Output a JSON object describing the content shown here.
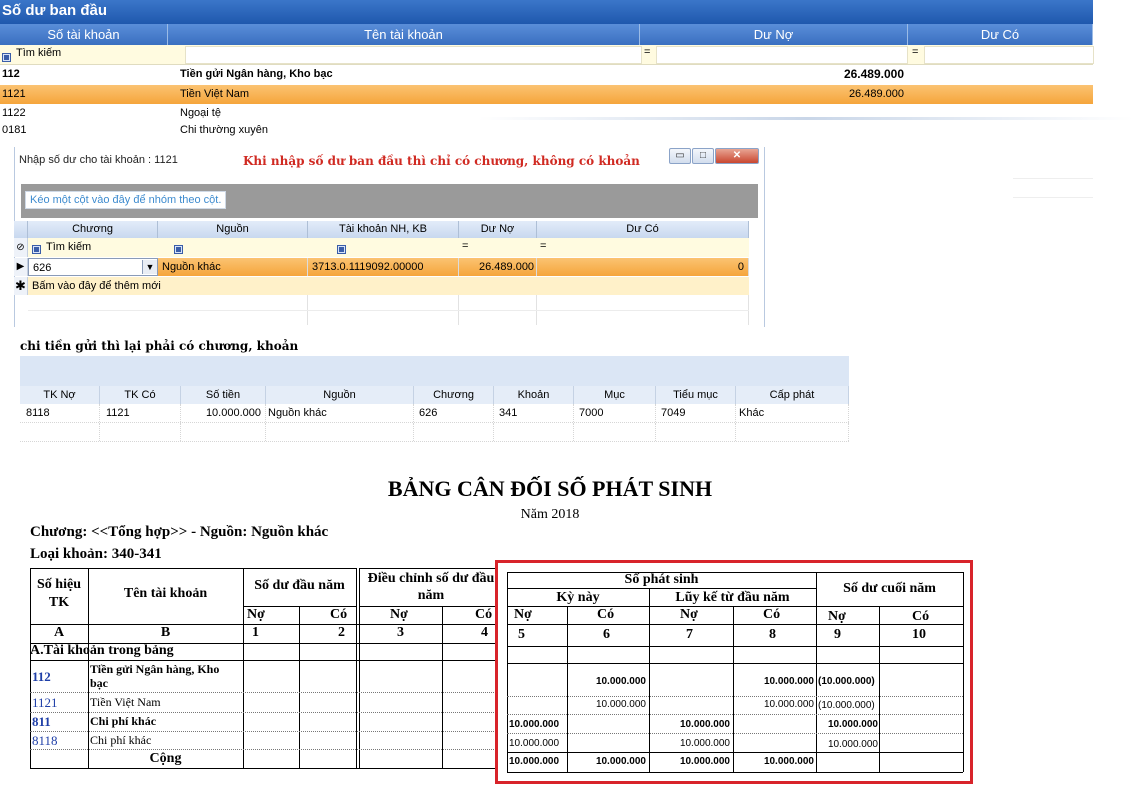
{
  "top_grid": {
    "title": "Số dư ban đầu",
    "columns": [
      "Số tài khoản",
      "Tên tài khoản",
      "Dư Nợ",
      "Dư Có"
    ],
    "filter_label": "Tìm kiếm",
    "filter_eq": "=",
    "rows": [
      {
        "code": "112",
        "name": "Tiền gửi Ngân hàng, Kho bạc",
        "debit": "26.489.000",
        "credit": "",
        "bold": true
      },
      {
        "code": "1121",
        "name": "Tiền Việt Nam",
        "debit": "26.489.000",
        "credit": "",
        "selected": true
      },
      {
        "code": "1122",
        "name": "Ngoại tệ",
        "debit": "",
        "credit": ""
      },
      {
        "code": "0181",
        "name": "Chi thường xuyên",
        "debit": "",
        "credit": ""
      }
    ]
  },
  "dialog": {
    "title": "Nhập số dư cho tài khoản : 1121",
    "note": "Khi nhập số dư ban đầu thì chỉ có chương, không có khoản",
    "group_hint": "Kéo một cột vào đây để nhóm theo cột.",
    "window_buttons": {
      "minimize": "▭",
      "maximize": "□",
      "close": "✕"
    },
    "columns": [
      "Chương",
      "Nguồn",
      "Tài khoản NH, KB",
      "Dư Nợ",
      "Dư Có"
    ],
    "filter_label": "Tìm kiếm",
    "filter_eq": "=",
    "row": {
      "chuong": "626",
      "nguon": "Nguồn khác",
      "tk_nh": "3713.0.1119092.00000",
      "du_no": "26.489.000",
      "du_co": "0"
    },
    "add_new": "Bấm vào đây để thêm mới"
  },
  "middle": {
    "caption": "chi tiền gửi thì lại phải có chương, khoản",
    "columns": [
      "TK Nợ",
      "TK Có",
      "Số tiền",
      "Nguồn",
      "Chương",
      "Khoản",
      "Mục",
      "Tiểu mục",
      "Cấp phát"
    ],
    "row": {
      "tk_no": "8118",
      "tk_co": "1121",
      "so_tien": "10.000.000",
      "nguon": "Nguồn khác",
      "chuong": "626",
      "khoan": "341",
      "muc": "7000",
      "tieu_muc": "7049",
      "cap_phat": "Khác"
    }
  },
  "report": {
    "title": "BẢNG CÂN ĐỐI SỐ PHÁT SINH",
    "year": "Năm 2018",
    "chuong_line": "Chương: <<Tổng hợp>> - Nguồn: Nguồn khác",
    "loai_line": "Loại khoản: 340-341",
    "h_so_hieu": "Số hiệu TK",
    "h_ten": "Tên tài khoản",
    "h_sddn": "Số dư đầu năm",
    "h_dieu_chinh": "Điều chỉnh số dư đầu năm",
    "h_spsinh": "Số phát sinh",
    "h_ky_nay": "Kỳ này",
    "h_luy_ke": "Lũy kế từ đầu năm",
    "h_sdcn": "Số dư cuối năm",
    "no": "Nợ",
    "co": "Có",
    "col_letters": [
      "A",
      "B"
    ],
    "col_numbers": [
      "1",
      "2",
      "3",
      "4",
      "5",
      "6",
      "7",
      "8",
      "9",
      "10"
    ],
    "section_a": "A.Tài khoản trong bảng",
    "rows": [
      {
        "code": "112",
        "name": "Tiền gửi Ngân hàng, Kho bạc",
        "c6": "10.000.000",
        "c8": "10.000.000",
        "c9": "(10.000.000)"
      },
      {
        "code": "1121",
        "name": "Tiền Việt Nam",
        "c6": "10.000.000",
        "c8": "10.000.000",
        "c9": "(10.000.000)"
      },
      {
        "code": "811",
        "name": "Chi phí khác",
        "c5": "10.000.000",
        "c7": "10.000.000",
        "c9": "10.000.000"
      },
      {
        "code": "8118",
        "name": "Chi phí khác",
        "c5": "10.000.000",
        "c7": "10.000.000",
        "c9": "10.000.000"
      }
    ],
    "total_label": "Cộng",
    "total": {
      "c5": "10.000.000",
      "c6": "10.000.000",
      "c7": "10.000.000",
      "c8": "10.000.000"
    }
  }
}
